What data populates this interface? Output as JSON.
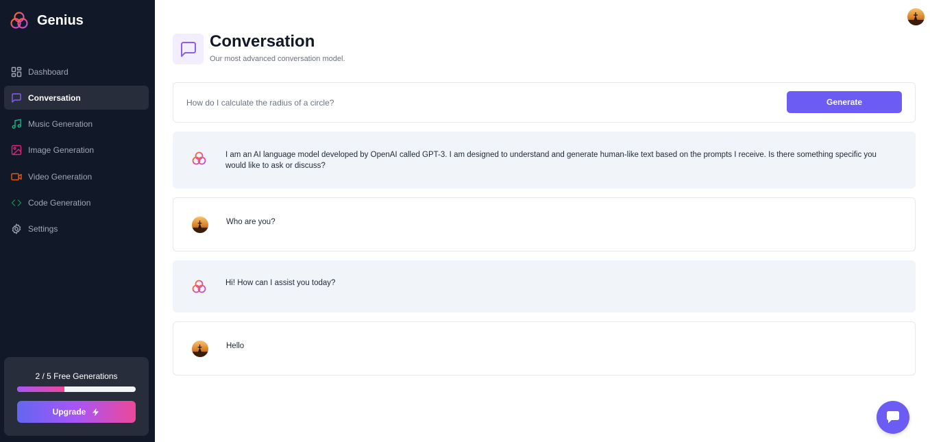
{
  "brand": {
    "name": "Genius"
  },
  "sidebar": {
    "items": [
      {
        "label": "Dashboard",
        "icon": "dashboard-icon",
        "color": "#a1a7b4",
        "active": false
      },
      {
        "label": "Conversation",
        "icon": "message-square-icon",
        "color": "#8b5cf6",
        "active": true
      },
      {
        "label": "Music Generation",
        "icon": "music-icon",
        "color": "#10b981",
        "active": false
      },
      {
        "label": "Image Generation",
        "icon": "image-icon",
        "color": "#db2777",
        "active": false
      },
      {
        "label": "Video Generation",
        "icon": "video-icon",
        "color": "#ea580c",
        "active": false
      },
      {
        "label": "Code Generation",
        "icon": "code-icon",
        "color": "#15803d",
        "active": false
      },
      {
        "label": "Settings",
        "icon": "gear-icon",
        "color": "#a1a7b4",
        "active": false
      }
    ]
  },
  "usage": {
    "text": "2 / 5 Free Generations",
    "used": 2,
    "limit": 5,
    "progress_fraction": 0.4
  },
  "upgrade": {
    "label": "Upgrade"
  },
  "heading": {
    "title": "Conversation",
    "subtitle": "Our most advanced conversation model.",
    "icon_color": "#8b5cf6"
  },
  "prompt": {
    "placeholder": "How do I calculate the radius of a circle?",
    "generate_label": "Generate"
  },
  "messages": [
    {
      "role": "bot",
      "text": "I am an AI language model developed by OpenAI called GPT-3. I am designed to understand and generate human-like text based on the prompts I receive. Is there something specific you would like to ask or discuss?"
    },
    {
      "role": "user",
      "text": "Who are you?"
    },
    {
      "role": "bot",
      "text": "Hi! How can I assist you today?"
    },
    {
      "role": "user",
      "text": "Hello"
    }
  ],
  "colors": {
    "sidebar_bg": "#111827",
    "accent": "#6d5cf4",
    "bot_bg": "#f1f4f8"
  }
}
